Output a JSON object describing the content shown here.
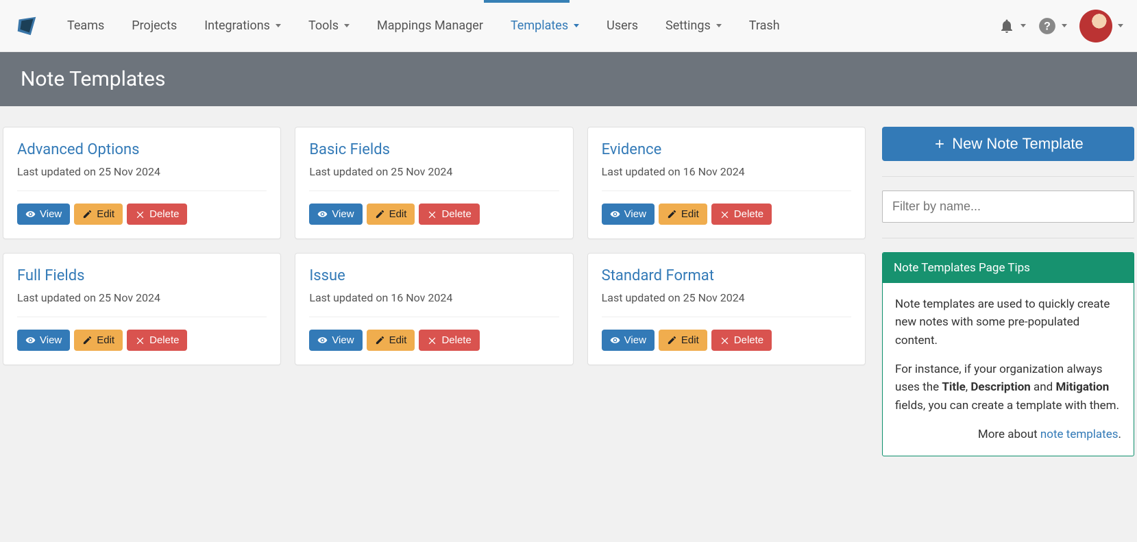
{
  "nav": {
    "items": [
      {
        "label": "Teams",
        "dropdown": false,
        "active": false
      },
      {
        "label": "Projects",
        "dropdown": false,
        "active": false
      },
      {
        "label": "Integrations",
        "dropdown": true,
        "active": false
      },
      {
        "label": "Tools",
        "dropdown": true,
        "active": false
      },
      {
        "label": "Mappings Manager",
        "dropdown": false,
        "active": false
      },
      {
        "label": "Templates",
        "dropdown": true,
        "active": true
      },
      {
        "label": "Users",
        "dropdown": false,
        "active": false
      },
      {
        "label": "Settings",
        "dropdown": true,
        "active": false
      },
      {
        "label": "Trash",
        "dropdown": false,
        "active": false
      }
    ]
  },
  "page": {
    "title": "Note Templates"
  },
  "templates": [
    {
      "name": "Advanced Options",
      "updated": "Last updated on 25 Nov 2024"
    },
    {
      "name": "Basic Fields",
      "updated": "Last updated on 25 Nov 2024"
    },
    {
      "name": "Evidence",
      "updated": "Last updated on 16 Nov 2024"
    },
    {
      "name": "Full Fields",
      "updated": "Last updated on 25 Nov 2024"
    },
    {
      "name": "Issue",
      "updated": "Last updated on 16 Nov 2024"
    },
    {
      "name": "Standard Format",
      "updated": "Last updated on 25 Nov 2024"
    }
  ],
  "card_actions": {
    "view": "View",
    "edit": "Edit",
    "delete": "Delete"
  },
  "sidebar": {
    "new_button": "New Note Template",
    "filter_placeholder": "Filter by name...",
    "tips_title": "Note Templates Page Tips",
    "tips_p1": "Note templates are used to quickly create new notes with some pre-populated content.",
    "tips_p2_prefix": "For instance, if your organization always uses the ",
    "tips_p2_b1": "Title",
    "tips_p2_sep1": ", ",
    "tips_p2_b2": "Description",
    "tips_p2_sep2": " and ",
    "tips_p2_b3": "Mitigation",
    "tips_p2_suffix": " fields, you can create a template with them.",
    "tips_more_prefix": "More about ",
    "tips_more_link": "note templates",
    "tips_more_suffix": "."
  }
}
